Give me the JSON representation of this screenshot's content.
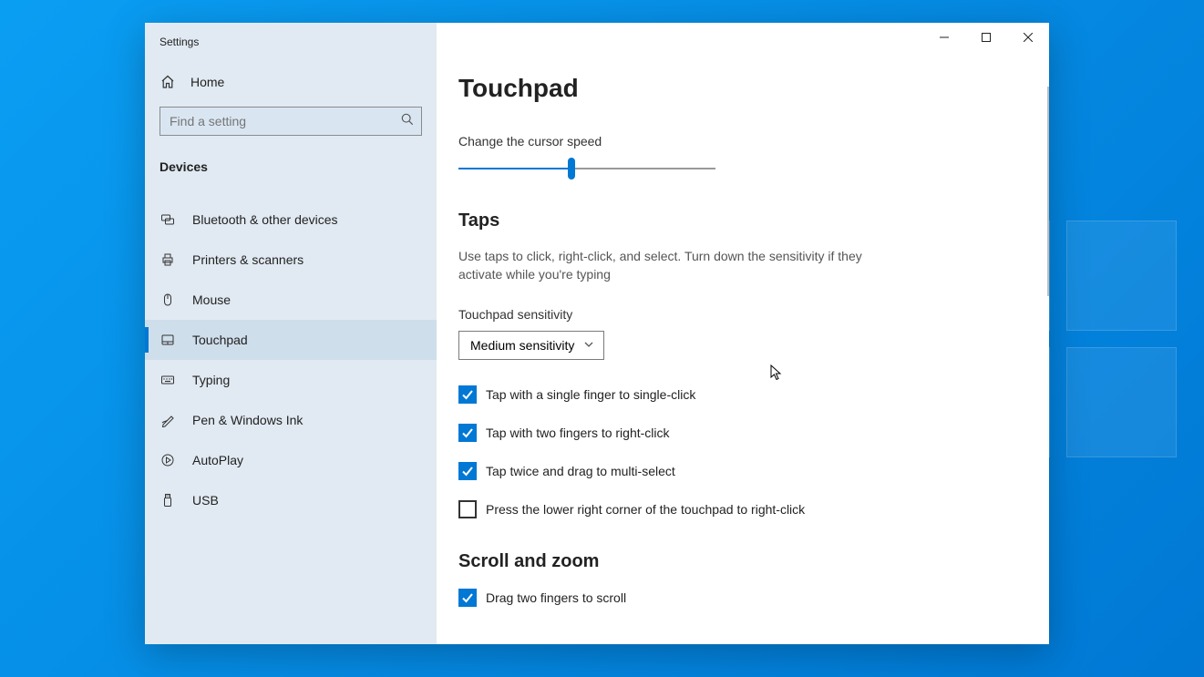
{
  "app_title": "Settings",
  "home_label": "Home",
  "search_placeholder": "Find a setting",
  "section_title": "Devices",
  "nav_items": [
    {
      "label": "Bluetooth & other devices"
    },
    {
      "label": "Printers & scanners"
    },
    {
      "label": "Mouse"
    },
    {
      "label": "Touchpad"
    },
    {
      "label": "Typing"
    },
    {
      "label": "Pen & Windows Ink"
    },
    {
      "label": "AutoPlay"
    },
    {
      "label": "USB"
    }
  ],
  "page_heading": "Touchpad",
  "cursor_speed_label": "Change the cursor speed",
  "taps": {
    "title": "Taps",
    "desc": "Use taps to click, right-click, and select. Turn down the sensitivity if they activate while you're typing",
    "sensitivity_label": "Touchpad sensitivity",
    "sensitivity_value": "Medium sensitivity",
    "check1": "Tap with a single finger to single-click",
    "check2": "Tap with two fingers to right-click",
    "check3": "Tap twice and drag to multi-select",
    "check4": "Press the lower right corner of the touchpad to right-click"
  },
  "scroll_zoom": {
    "title": "Scroll and zoom",
    "check1": "Drag two fingers to scroll"
  }
}
